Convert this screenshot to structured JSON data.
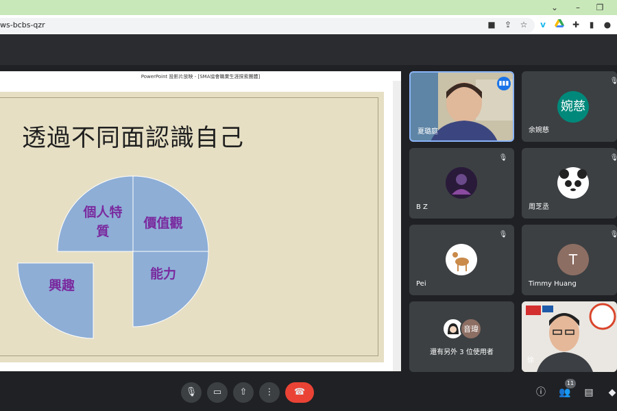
{
  "browser": {
    "url": "ws-bcbs-qzr",
    "window_controls": [
      "minimize",
      "restore"
    ],
    "toolbar_icons": [
      "camera-icon",
      "share-icon",
      "star-icon",
      "vimeo-icon",
      "drive-icon",
      "extensions-icon",
      "sidebar-icon",
      "profile-icon"
    ]
  },
  "presentation": {
    "window_title": "PowerPoint 投影片放映 - [SMA協會職業生涯探索團體]",
    "slide_title": "透過不同面認識自己",
    "quadrants": [
      {
        "label_line1": "個人特",
        "label_line2": "質"
      },
      {
        "label": "價值觀"
      },
      {
        "label": "興趣"
      },
      {
        "label": "能力"
      }
    ],
    "colors": {
      "quadrant_fill": "#8eaed6",
      "slide_bg": "#e6dfc4",
      "label_color": "#7a2a9e"
    }
  },
  "participants": [
    {
      "name": "夏璐庭",
      "speaking": true
    },
    {
      "name": "余婉慈",
      "avatar_text": "婉慈",
      "avatar_color": "#00897b"
    },
    {
      "name": "B Z"
    },
    {
      "name": "周芝丞"
    },
    {
      "name": "Pei"
    },
    {
      "name": "Timmy Huang",
      "avatar_text": "T",
      "avatar_color": "#8d6e63"
    },
    {
      "name": "還有另外 3 位使用者",
      "avatar_text": "音瑋",
      "avatar_color": "#8d6e63"
    },
    {
      "name": "徐"
    }
  ],
  "controls": {
    "center": [
      "mic-icon",
      "camera-icon",
      "present-icon",
      "more-icon",
      "hangup-icon"
    ],
    "right": [
      "info-icon",
      "people-icon",
      "chat-icon",
      "activities-icon"
    ],
    "people_count": "11",
    "hangup_color": "#ea4335"
  }
}
